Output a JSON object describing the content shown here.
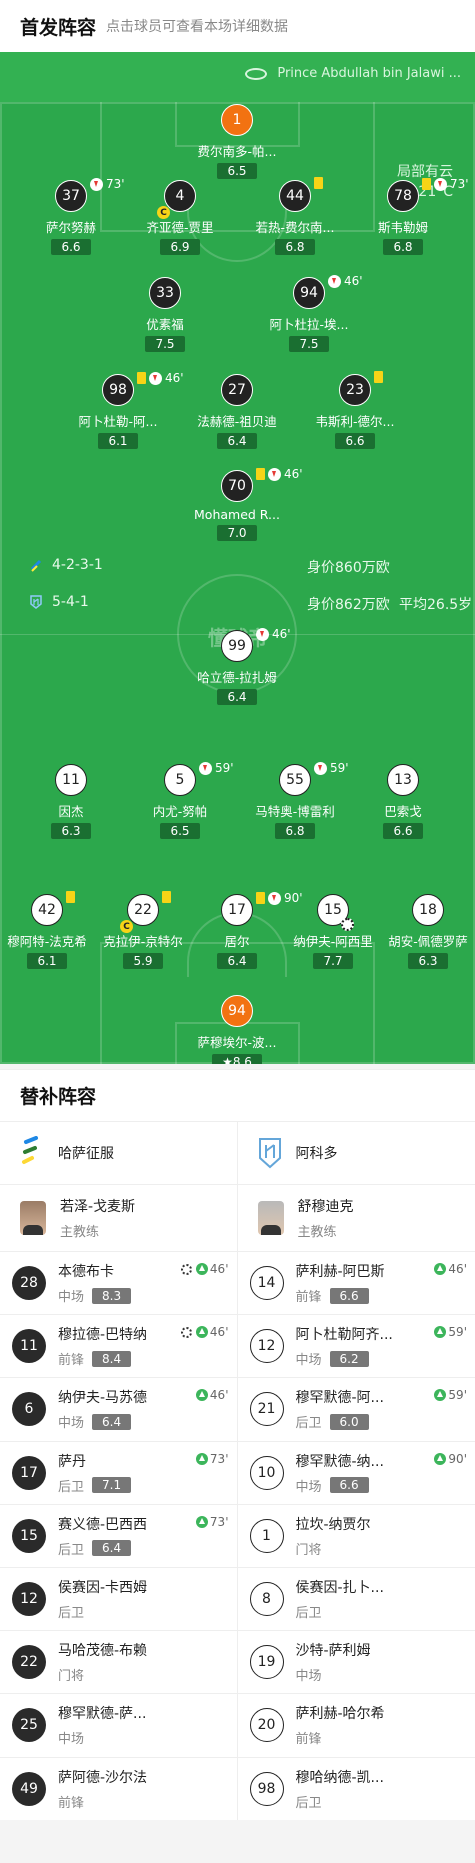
{
  "header": {
    "title": "首发阵容",
    "subtitle": "点击球员可查看本场详细数据"
  },
  "venue": {
    "name": "Prince Abdullah bin Jalawi ...",
    "weather": "局部有云",
    "temperature": "21°C"
  },
  "home_team": {
    "formation": "4-2-3-1",
    "value": "身价860万欧",
    "players": [
      {
        "num": "1",
        "name": "费尔南多-帕...",
        "rating": "6.5",
        "style": "gk"
      },
      {
        "num": "37",
        "name": "萨尔努赫",
        "rating": "6.6",
        "sub_min": "73'"
      },
      {
        "num": "4",
        "name": "齐亚德-贾里",
        "rating": "6.9",
        "captain": "C"
      },
      {
        "num": "44",
        "name": "若热-费尔南...",
        "rating": "6.8",
        "yellow": true
      },
      {
        "num": "78",
        "name": "斯韦勒姆",
        "rating": "6.8",
        "yellow": true,
        "sub_min": "73'"
      },
      {
        "num": "33",
        "name": "优素福",
        "rating": "7.5"
      },
      {
        "num": "94",
        "name": "阿卜杜拉-埃...",
        "rating": "7.5",
        "sub_min": "46'"
      },
      {
        "num": "98",
        "name": "阿卜杜勒-阿...",
        "rating": "6.1",
        "yellow": true,
        "sub_min": "46'"
      },
      {
        "num": "27",
        "name": "法赫德-祖贝迪",
        "rating": "6.4"
      },
      {
        "num": "23",
        "name": "韦斯利-德尔...",
        "rating": "6.6",
        "yellow": true
      },
      {
        "num": "70",
        "name": "Mohamed R...",
        "rating": "7.0",
        "yellow": true,
        "sub_min": "46'"
      }
    ]
  },
  "away_team": {
    "formation": "5-4-1",
    "value": "身价862万欧",
    "avg_age": "平均26.5岁",
    "players": [
      {
        "num": "99",
        "name": "哈立德-拉扎姆",
        "rating": "6.4",
        "sub_min": "46'"
      },
      {
        "num": "11",
        "name": "因杰",
        "rating": "6.3"
      },
      {
        "num": "5",
        "name": "内尤-努帕",
        "rating": "6.5",
        "sub_min": "59'"
      },
      {
        "num": "55",
        "name": "马特奥-博雷利",
        "rating": "6.8",
        "sub_min": "59'"
      },
      {
        "num": "13",
        "name": "巴索戈",
        "rating": "6.6"
      },
      {
        "num": "42",
        "name": "穆阿特-法克希",
        "rating": "6.1",
        "yellow": true
      },
      {
        "num": "22",
        "name": "克拉伊-京特尔",
        "rating": "5.9",
        "yellow": true,
        "captain": "C"
      },
      {
        "num": "17",
        "name": "居尔",
        "rating": "6.4",
        "yellow": true,
        "sub_min": "90'"
      },
      {
        "num": "15",
        "name": "纳伊夫-阿西里",
        "rating": "7.7",
        "goal": true
      },
      {
        "num": "18",
        "name": "胡安-佩德罗萨",
        "rating": "6.3"
      },
      {
        "num": "94",
        "name": "萨穆埃尔-波...",
        "rating": "8.6",
        "style": "gk",
        "star": true
      }
    ]
  },
  "watermark": "懂球帝",
  "subs": {
    "title": "替补阵容",
    "home": {
      "team_name": "哈萨征服",
      "coach_name": "若泽-戈麦斯",
      "coach_role": "主教练",
      "players": [
        {
          "num": "28",
          "name": "本德布卡",
          "pos": "中场",
          "rating": "8.3",
          "event": "46'",
          "goal": true
        },
        {
          "num": "11",
          "name": "穆拉德-巴特纳",
          "pos": "前锋",
          "rating": "8.4",
          "event": "46'",
          "goal": true
        },
        {
          "num": "6",
          "name": "纳伊夫-马苏德",
          "pos": "中场",
          "rating": "6.4",
          "event": "46'"
        },
        {
          "num": "17",
          "name": "萨丹",
          "pos": "后卫",
          "rating": "7.1",
          "event": "73'"
        },
        {
          "num": "15",
          "name": "赛义德-巴西西",
          "pos": "后卫",
          "rating": "6.4",
          "event": "73'"
        },
        {
          "num": "12",
          "name": "侯赛因-卡西姆",
          "pos": "后卫"
        },
        {
          "num": "22",
          "name": "马哈茂德-布赖",
          "pos": "门将"
        },
        {
          "num": "25",
          "name": "穆罕默德-萨...",
          "pos": "中场"
        },
        {
          "num": "49",
          "name": "萨阿德-沙尔法",
          "pos": "前锋"
        }
      ]
    },
    "away": {
      "team_name": "阿科多",
      "coach_name": "舒穆迪克",
      "coach_role": "主教练",
      "players": [
        {
          "num": "14",
          "name": "萨利赫-阿巴斯",
          "pos": "前锋",
          "rating": "6.6",
          "event": "46'"
        },
        {
          "num": "12",
          "name": "阿卜杜勒阿齐...",
          "pos": "中场",
          "rating": "6.2",
          "event": "59'"
        },
        {
          "num": "21",
          "name": "穆罕默德-阿...",
          "pos": "后卫",
          "rating": "6.0",
          "event": "59'"
        },
        {
          "num": "10",
          "name": "穆罕默德-纳...",
          "pos": "中场",
          "rating": "6.6",
          "event": "90'"
        },
        {
          "num": "1",
          "name": "拉坎-纳贾尔",
          "pos": "门将"
        },
        {
          "num": "8",
          "name": "侯赛因-扎卜...",
          "pos": "后卫"
        },
        {
          "num": "19",
          "name": "沙特-萨利姆",
          "pos": "中场"
        },
        {
          "num": "20",
          "name": "萨利赫-哈尔希",
          "pos": "前锋"
        },
        {
          "num": "98",
          "name": "穆哈纳德-凯...",
          "pos": "后卫"
        }
      ]
    }
  },
  "colors": {
    "pitch": "#2ca84c",
    "goalkeeper": "#f27211",
    "home_shirt": "#222222",
    "away_shirt": "#ffffff",
    "rating_bg": "#1a6f31"
  }
}
